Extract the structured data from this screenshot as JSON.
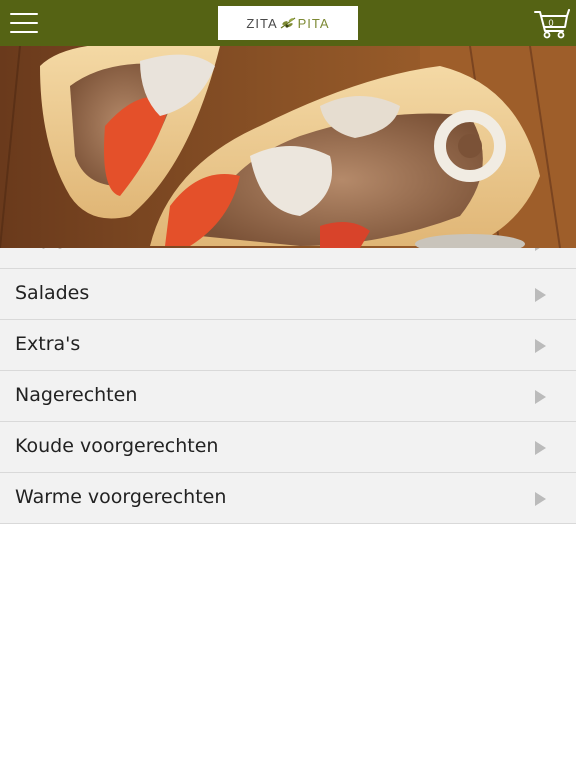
{
  "header": {
    "background": "#556314",
    "logo": {
      "text_left": "ZITA",
      "text_right": "PITA"
    },
    "cart": {
      "count": "0"
    }
  },
  "menu": {
    "items": [
      {
        "label": "Pita's"
      },
      {
        "label": "Salades"
      },
      {
        "label": "Extra's"
      },
      {
        "label": "Nagerechten"
      },
      {
        "label": "Koude voorgerechten"
      },
      {
        "label": "Warme voorgerechten"
      }
    ]
  },
  "icons": {
    "menu": "hamburger-icon",
    "cart": "cart-icon",
    "row_arrow": "chevron-right-icon"
  }
}
